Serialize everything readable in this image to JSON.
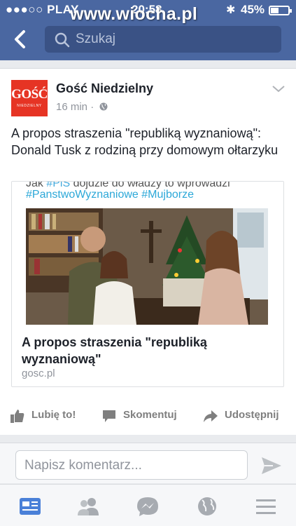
{
  "status_bar": {
    "carrier": "●●●○○ PLAY",
    "time": "20:58",
    "battery_percent": "45%",
    "battery_level": 0.45
  },
  "watermark": "www.wiocha.pl",
  "search": {
    "placeholder": "Szukaj"
  },
  "post": {
    "page_name": "Gość Niedzielny",
    "logo_text": "GOŚĆ",
    "logo_subtext": "NIEDZIELNY",
    "time": "16 min",
    "text": "A propos straszenia \"republiką wyznaniową\": Donald Tusk z rodziną przy domowym ołtarzyku",
    "link": {
      "tweet_line1_a": "Jak ",
      "tweet_line1_hashtag": "#PiS",
      "tweet_line1_b": " dojdzie do władzy to wprowadzi",
      "tweet_line2": "#PanstwoWyznaniowe #Mujborze",
      "title": "A propos straszenia \"republiką wyznaniową\"",
      "domain": "gosc.pl"
    },
    "actions": {
      "like": "Lubię to!",
      "comment": "Skomentuj",
      "share": "Udostępnij"
    }
  },
  "comment_input": {
    "placeholder": "Napisz komentarz..."
  },
  "tabs": [
    {
      "icon": "news-feed-icon",
      "active": true
    },
    {
      "icon": "friends-icon",
      "active": false
    },
    {
      "icon": "messenger-icon",
      "active": false
    },
    {
      "icon": "notifications-globe-icon",
      "active": false
    },
    {
      "icon": "menu-icon",
      "active": false
    }
  ],
  "colors": {
    "facebook_blue": "#4a67a1",
    "active_tab": "#4a80d8",
    "logo_red": "#e63424"
  }
}
